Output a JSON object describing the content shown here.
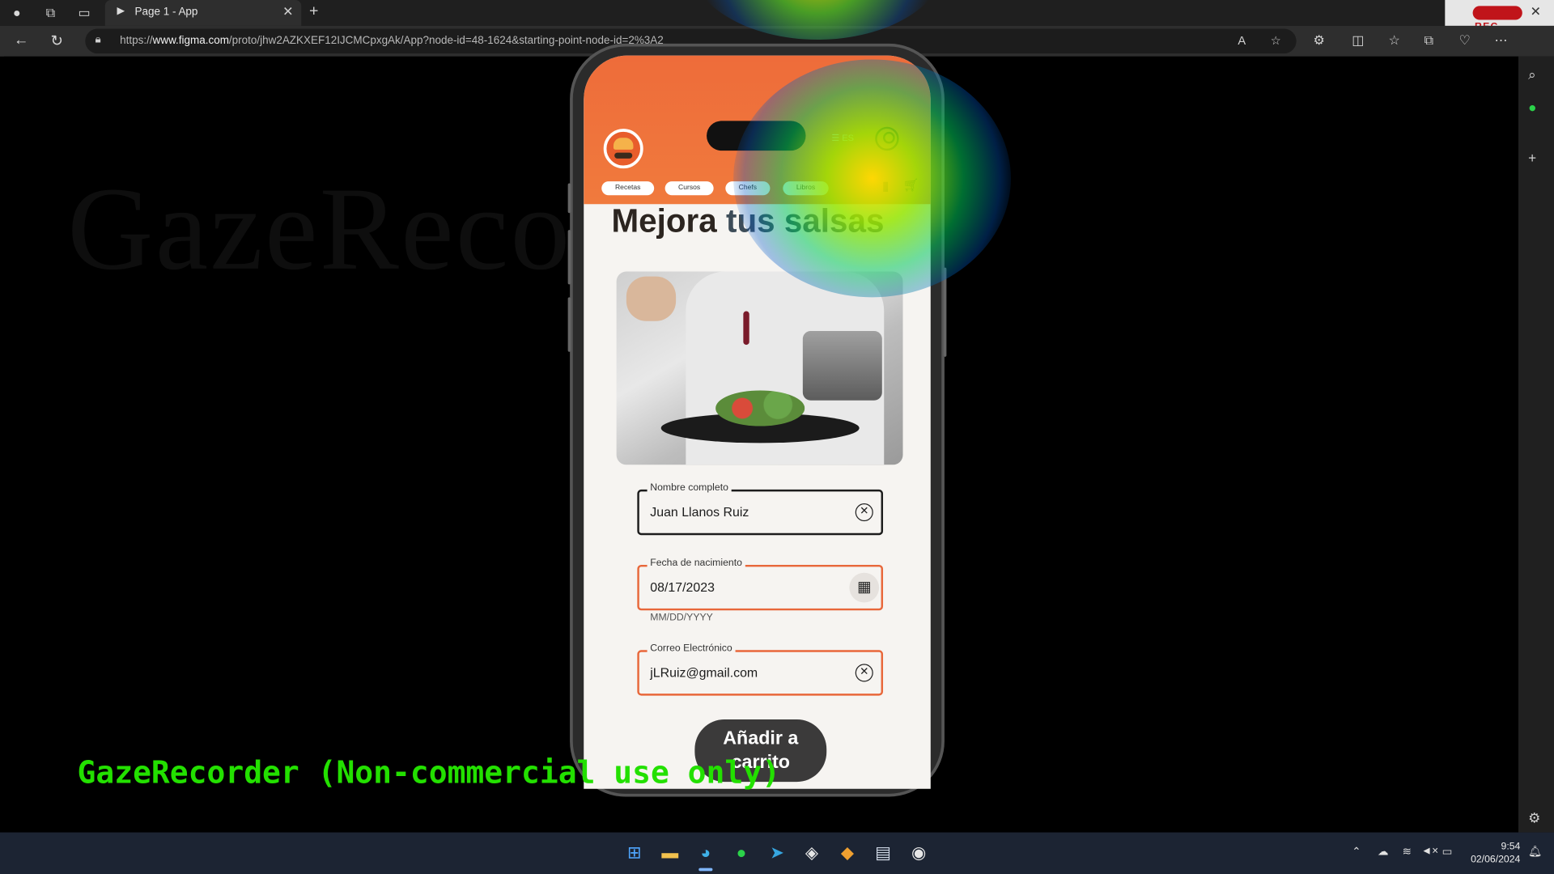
{
  "browser": {
    "tab_title": "Page 1 - App",
    "tab_favicon": "figma-play-icon",
    "url_prefix": "https://",
    "url_domain": "www.figma.com",
    "url_path": "/proto/jhw2AZKXEF12IJCMCpxgAk/App?node-id=48-1624&starting-point-node-id=2%3A2",
    "rec_label": "REC"
  },
  "app": {
    "lang_label": "ES",
    "nav_chips": [
      "Recetas",
      "Cursos",
      "Chefs",
      "Libros"
    ],
    "headline_main": "Mejora",
    "headline_rest": "tus salsas",
    "form": {
      "name_label": "Nombre completo",
      "name_value": "Juan Llanos Ruiz",
      "dob_label": "Fecha de nacimiento",
      "dob_value": "08/17/2023",
      "dob_hint": "MM/DD/YYYY",
      "email_label": "Correo Electrónico",
      "email_value": "jLRuiz@gmail.com"
    },
    "cart_button_line1": "Añadir a",
    "cart_button_line2": "carrito",
    "colors": {
      "primary": "#EF6A36",
      "button": "#3B3A3A",
      "background": "#F6F4F1"
    }
  },
  "overlay": {
    "watermark_faint": "GazeRecor",
    "watermark_green": "GazeRecorder (Non-commercial use only)"
  },
  "taskbar": {
    "time": "9:54",
    "date": "02/06/2024"
  }
}
